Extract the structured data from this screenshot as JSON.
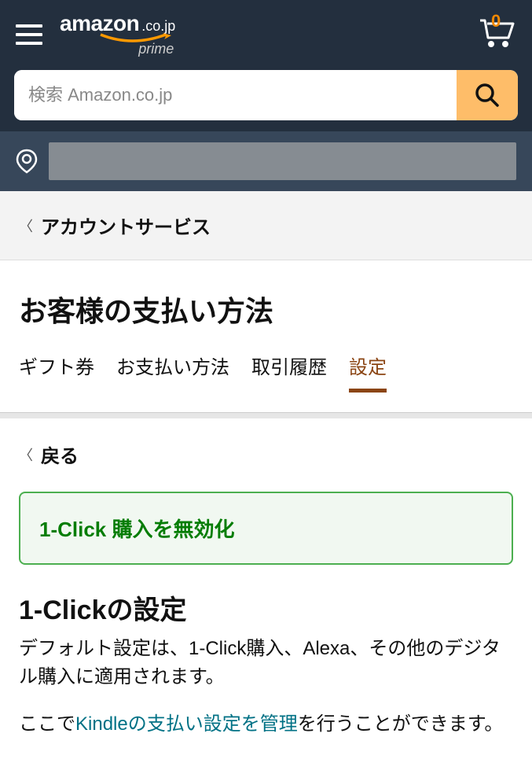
{
  "header": {
    "logo_text": "amazon",
    "logo_domain": ".co.jp",
    "logo_sub": "prime",
    "cart_count": "0"
  },
  "search": {
    "placeholder": "検索 Amazon.co.jp"
  },
  "breadcrumb": {
    "label": "アカウントサービス"
  },
  "page": {
    "title": "お客様の支払い方法"
  },
  "tabs": [
    {
      "label": "ギフト券"
    },
    {
      "label": "お支払い方法"
    },
    {
      "label": "取引履歴"
    },
    {
      "label": "設定"
    }
  ],
  "back": {
    "label": "戻る"
  },
  "success": {
    "message": "1-Click 購入を無効化"
  },
  "section": {
    "title": "1-Clickの設定",
    "description": "デフォルト設定は、1-Click購入、Alexa、その他のデジタル購入に適用されます。",
    "note_prefix": "ここで",
    "note_link": "Kindleの支払い設定を管理",
    "note_suffix": "を行うことができます。"
  }
}
